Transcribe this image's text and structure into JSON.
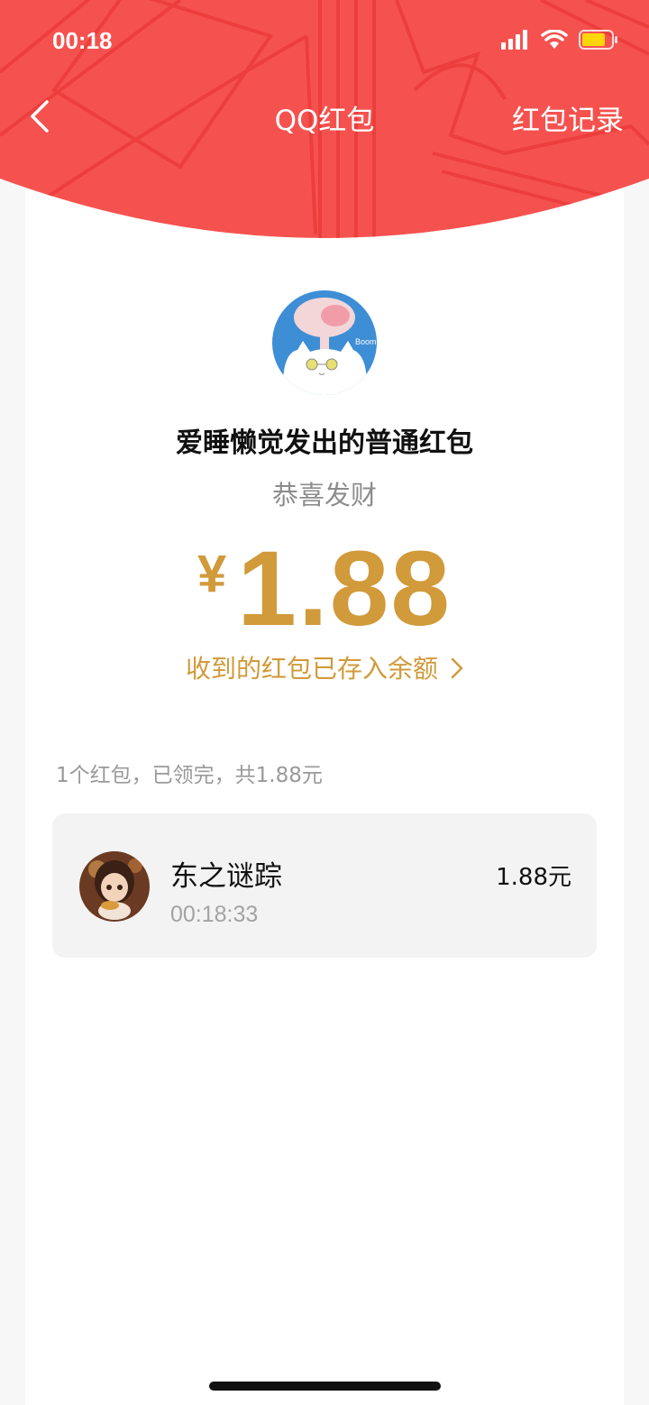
{
  "status_bar": {
    "time": "00:18"
  },
  "nav": {
    "title": "QQ红包",
    "records_label": "红包记录"
  },
  "packet": {
    "title": "爱睡懒觉发出的普通红包",
    "greeting": "恭喜发财",
    "currency": "¥",
    "amount": "1.88",
    "balance_link": "收到的红包已存入余额"
  },
  "summary": "1个红包，已领完，共1.88元",
  "receivers": [
    {
      "name": "东之谜踪",
      "time": "00:18:33",
      "amount": "1.88元"
    }
  ],
  "icons": {
    "back": "chevron-left-icon",
    "balance": "chevron-right-icon",
    "signal": "cellular-signal-icon",
    "wifi": "wifi-icon",
    "battery": "battery-icon"
  },
  "colors": {
    "header_red": "#f5524f",
    "gold": "#d19a3a",
    "battery": "#ffd60a"
  }
}
